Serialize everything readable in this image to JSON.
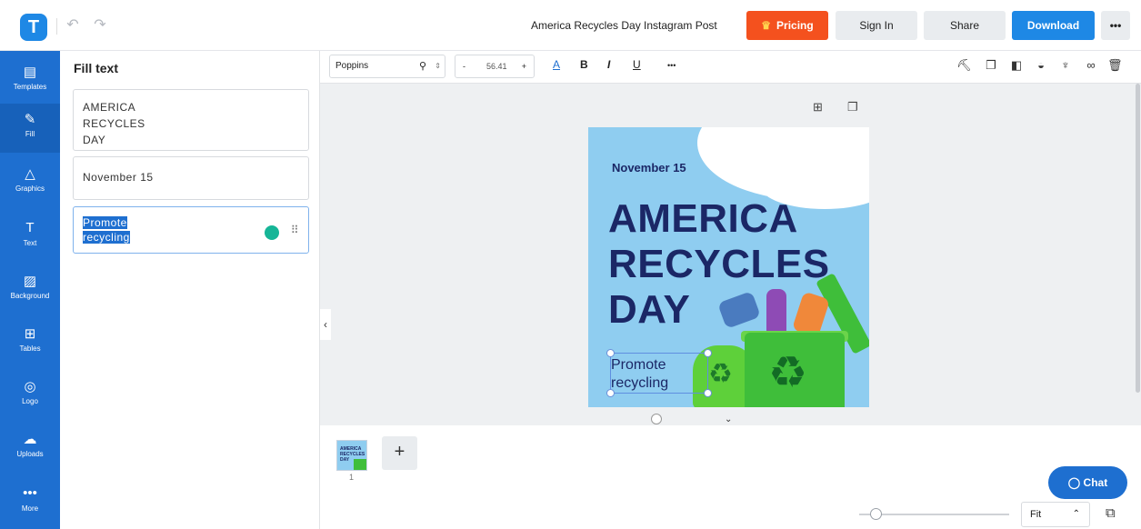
{
  "app": {
    "logo_letter": "T",
    "document_title": "America Recycles Day Instagram Post"
  },
  "header": {
    "undo_glyph": "↶",
    "redo_glyph": "↷",
    "pricing_label": "Pricing",
    "signin_label": "Sign In",
    "share_label": "Share",
    "download_label": "Download",
    "more_label": "•••"
  },
  "rail": {
    "items": [
      {
        "label": "Templates",
        "icon": "templates-icon",
        "glyph": "▤"
      },
      {
        "label": "Fill",
        "icon": "pencil-icon",
        "glyph": "✎"
      },
      {
        "label": "Graphics",
        "icon": "shapes-icon",
        "glyph": "△"
      },
      {
        "label": "Text",
        "icon": "text-icon",
        "glyph": "T"
      },
      {
        "label": "Background",
        "icon": "background-icon",
        "glyph": "▨"
      },
      {
        "label": "Tables",
        "icon": "table-icon",
        "glyph": "⊞"
      },
      {
        "label": "Logo",
        "icon": "logo-icon",
        "glyph": "◎"
      },
      {
        "label": "Uploads",
        "icon": "upload-cloud-icon",
        "glyph": "☁"
      },
      {
        "label": "More",
        "icon": "more-icon",
        "glyph": "•••"
      }
    ],
    "active": "Fill"
  },
  "panel": {
    "title": "Fill text",
    "fields": [
      "AMERICA\nRECYCLES\nDAY",
      "November 15",
      "Promote\nrecycling"
    ]
  },
  "toolbar": {
    "font_name": "Poppins",
    "font_size": "56.41",
    "minus": "-",
    "plus": "+",
    "color_glyph": "A",
    "bold_glyph": "B",
    "italic_glyph": "I",
    "underline_glyph": "U",
    "more_glyph": "•••"
  },
  "design": {
    "date": "November 15",
    "title": "AMERICA\nRECYCLES\nDAY",
    "subtitle": "Promote\nrecycling",
    "background_color": "#8fcdf0",
    "text_color": "#1b2766"
  },
  "pages": {
    "thumb_title": "AMERICA\nRECYCLES\nDAY",
    "page_number": "1",
    "add_label": "+"
  },
  "chat": {
    "label": "Chat"
  },
  "zoom": {
    "mode": "Fit"
  },
  "colors": {
    "accent": "#1e88e5",
    "pricing": "#f4511e",
    "rail": "#1e6fd0"
  }
}
